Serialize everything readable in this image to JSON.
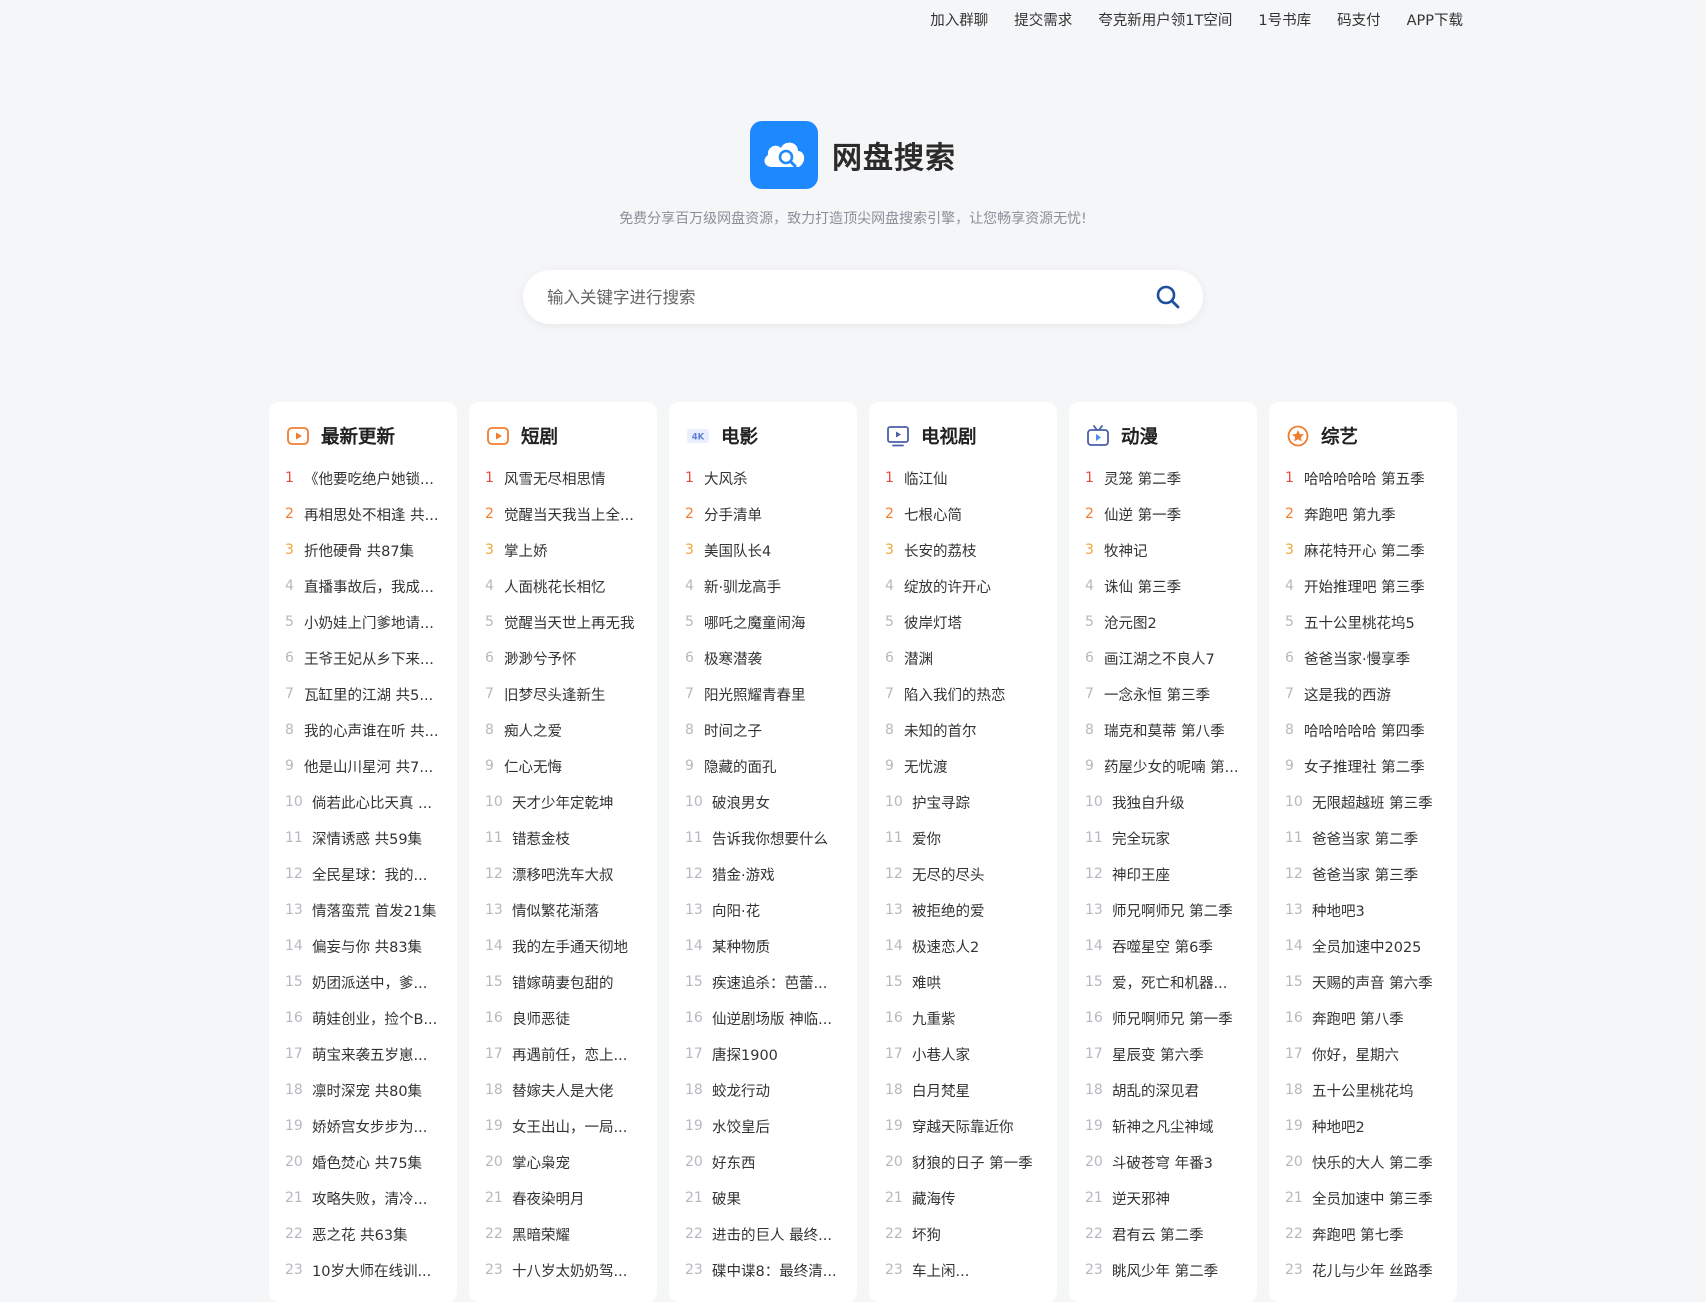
{
  "topnav": {
    "items": [
      "加入群聊",
      "提交需求",
      "夸克新用户领1T空间",
      "1号书库",
      "码支付",
      "APP下载"
    ]
  },
  "brand": {
    "title": "网盘搜索",
    "tagline": "免费分享百万级网盘资源，致力打造顶尖网盘搜索引擎，让您畅享资源无忧!",
    "logo_icon": "cloud-search-icon",
    "accent": "#1e88ff"
  },
  "search": {
    "placeholder": "输入关键字进行搜索",
    "value": "",
    "icon": "search-icon"
  },
  "colors": {
    "rank1": "#e74c3c",
    "rank2": "#f07c2e",
    "rank3": "#f2a53a",
    "rank_other": "#b5b8be"
  },
  "columns": [
    {
      "title": "最新更新",
      "icon": "play-square-icon",
      "items": [
        "《他要吃绝户她锁...",
        "再相思处不相逢 共...",
        "折他硬骨 共87集",
        "直播事故后，我成...",
        "小奶娃上门爹地请...",
        "王爷王妃从乡下来...",
        "瓦缸里的江湖 共5...",
        "我的心声谁在听 共...",
        "他是山川星河 共7...",
        "倘若此心比天真 ...",
        "深情诱惑 共59集",
        "全民星球：我的...",
        "情落蛮荒 首发21集",
        "偏妄与你 共83集",
        "奶团派送中，爹...",
        "萌娃创业，捡个B...",
        "萌宝来袭五岁崽...",
        "凛时深宠 共80集",
        "娇娇宫女步步为...",
        "婚色焚心 共75集",
        "攻略失败，清冷...",
        "恶之花 共63集",
        "10岁大师在线训..."
      ]
    },
    {
      "title": "短剧",
      "icon": "play-square-icon",
      "items": [
        "风雪无尽相思情",
        "觉醒当天我当上全...",
        "掌上娇",
        "人面桃花长相忆",
        "觉醒当天世上再无我",
        "渺渺兮予怀",
        "旧梦尽头逢新生",
        "痴人之爱",
        "仁心无悔",
        "天才少年定乾坤",
        "错惹金枝",
        "漂移吧洗车大叔",
        "情似繁花渐落",
        "我的左手通天彻地",
        "错嫁萌妻包甜的",
        "良师恶徒",
        "再遇前任，恋上...",
        "替嫁夫人是大佬",
        "女王出山，一局...",
        "掌心枭宠",
        "春夜染明月",
        "黑暗荣耀",
        "十八岁太奶奶驾..."
      ]
    },
    {
      "title": "电影",
      "icon": "4k-icon",
      "items": [
        "大风杀",
        "分手清单",
        "美国队长4",
        "新·驯龙高手",
        "哪吒之魔童闹海",
        "极寒潜袭",
        "阳光照耀青春里",
        "时间之子",
        "隐藏的面孔",
        "破浪男女",
        "告诉我你想要什么",
        "猎金·游戏",
        "向阳·花",
        "某种物质",
        "疾速追杀：芭蕾...",
        "仙逆剧场版 神临...",
        "唐探1900",
        "蛟龙行动",
        "水饺皇后",
        "好东西",
        "破果",
        "进击的巨人 最终...",
        "碟中谍8：最终清..."
      ]
    },
    {
      "title": "电视剧",
      "icon": "tv-icon",
      "items": [
        "临江仙",
        "七根心简",
        "长安的荔枝",
        "绽放的许开心",
        "彼岸灯塔",
        "潜渊",
        "陷入我们的热恋",
        "未知的首尔",
        "无忧渡",
        "护宝寻踪",
        "爱你",
        "无尽的尽头",
        "被拒绝的爱",
        "极速恋人2",
        "难哄",
        "九重紫",
        "小巷人家",
        "白月梵星",
        "穿越天际靠近你",
        "豺狼的日子 第一季",
        "藏海传",
        "坏狗",
        "车上闲..."
      ]
    },
    {
      "title": "动漫",
      "icon": "anime-tv-icon",
      "items": [
        "灵笼 第二季",
        "仙逆 第一季",
        "牧神记",
        "诛仙 第三季",
        "沧元图2",
        "画江湖之不良人7",
        "一念永恒 第三季",
        "瑞克和莫蒂 第八季",
        "药屋少女的呢喃 第...",
        "我独自升级",
        "完全玩家",
        "神印王座",
        "师兄啊师兄 第二季",
        "吞噬星空 第6季",
        "爱，死亡和机器...",
        "师兄啊师兄 第一季",
        "星辰变 第六季",
        "胡乱的深见君",
        "斩神之凡尘神域",
        "斗破苍穹 年番3",
        "逆天邪神",
        "君有云 第二季",
        "眺风少年 第二季"
      ]
    },
    {
      "title": "综艺",
      "icon": "star-circle-icon",
      "items": [
        "哈哈哈哈哈 第五季",
        "奔跑吧 第九季",
        "麻花特开心 第二季",
        "开始推理吧 第三季",
        "五十公里桃花坞5",
        "爸爸当家·慢享季",
        "这是我的西游",
        "哈哈哈哈哈 第四季",
        "女子推理社 第二季",
        "无限超越班 第三季",
        "爸爸当家 第二季",
        "爸爸当家 第三季",
        "种地吧3",
        "全员加速中2025",
        "天赐的声音 第六季",
        "奔跑吧 第八季",
        "你好，星期六",
        "五十公里桃花坞",
        "种地吧2",
        "快乐的大人 第二季",
        "全员加速中 第三季",
        "奔跑吧 第七季",
        "花儿与少年 丝路季"
      ]
    }
  ]
}
